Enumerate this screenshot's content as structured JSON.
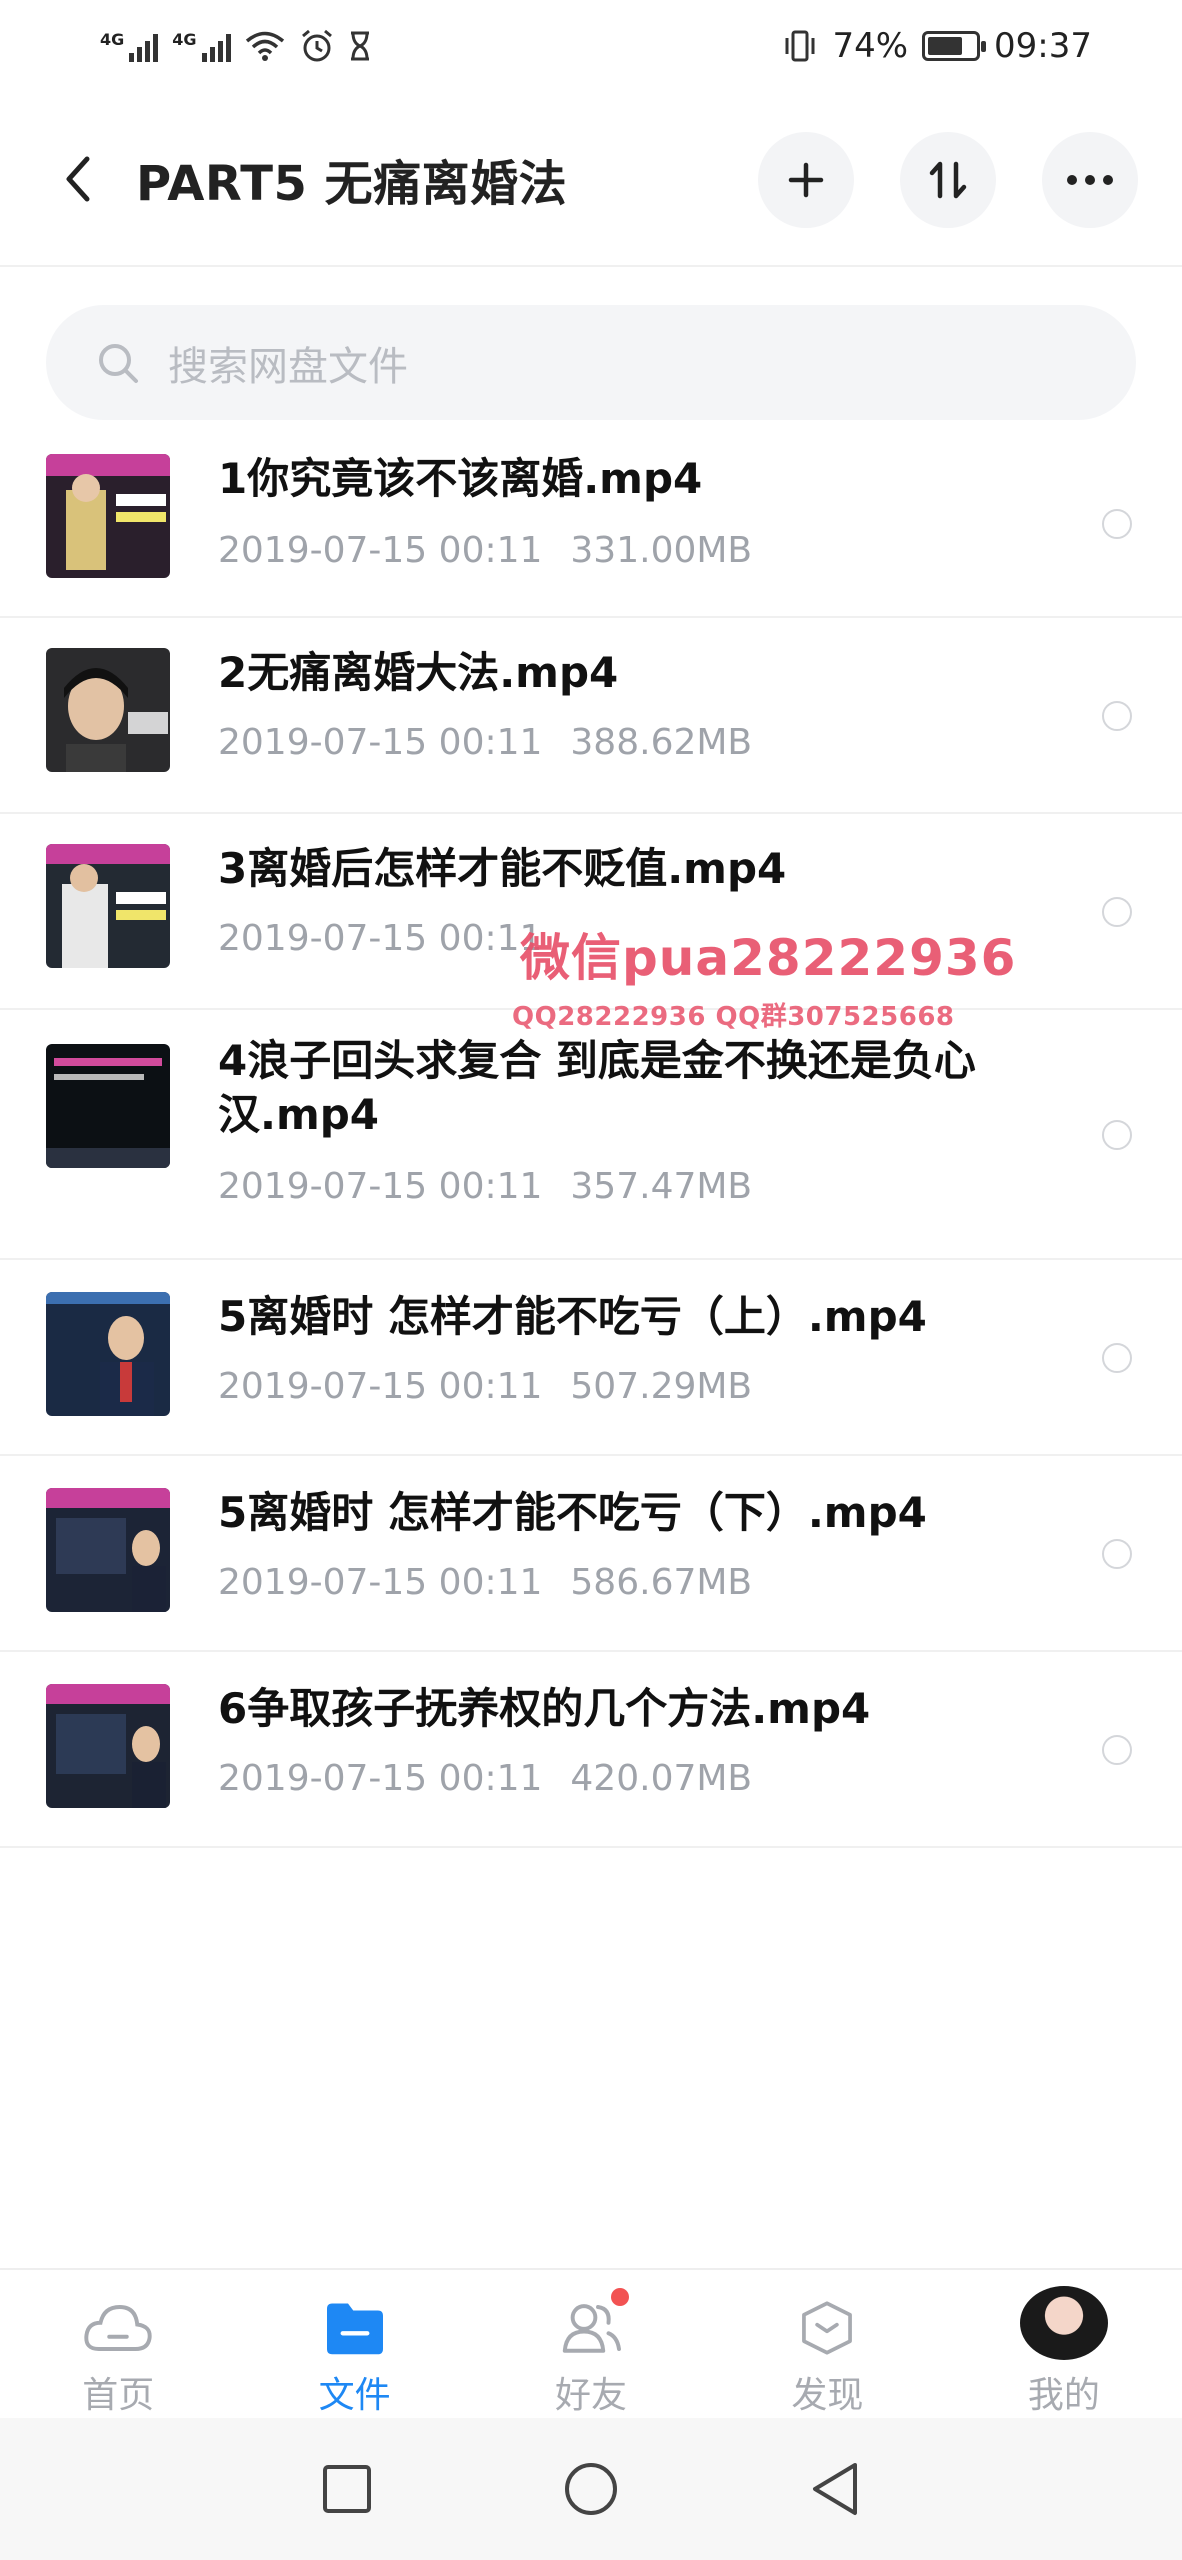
{
  "status_bar": {
    "net_1": "4G",
    "net_2": "4G",
    "battery": "74%",
    "battery_level": 0.74,
    "time": "09:37"
  },
  "header": {
    "title": "PART5 无痛离婚法"
  },
  "search": {
    "placeholder": "搜索网盘文件"
  },
  "files": [
    {
      "name": "1你究竟该不该离婚.mp4",
      "date": "2019-07-15  00:11",
      "size": "331.00MB",
      "thumb_color": "#2a1f2c"
    },
    {
      "name": "2无痛离婚大法.mp4",
      "date": "2019-07-15  00:11",
      "size": "388.62MB",
      "thumb_color": "#2b2b2d"
    },
    {
      "name": "3离婚后怎样才能不贬值.mp4",
      "date": "2019-07-15  00:11",
      "size": "",
      "thumb_color": "#232a33"
    },
    {
      "name": "4浪子回头求复合 到底是金不换还是负心汉.mp4",
      "date": "2019-07-15  00:11",
      "size": "357.47MB",
      "thumb_color": "#0c1014"
    },
    {
      "name": "5离婚时 怎样才能不吃亏（上）.mp4",
      "date": "2019-07-15  00:11",
      "size": "507.29MB",
      "thumb_color": "#1a2a44"
    },
    {
      "name": "5离婚时 怎样才能不吃亏（下）.mp4",
      "date": "2019-07-15  00:11",
      "size": "586.67MB",
      "thumb_color": "#1c2436"
    },
    {
      "name": "6争取孩子抚养权的几个方法.mp4",
      "date": "2019-07-15  00:11",
      "size": "420.07MB",
      "thumb_color": "#1d2433"
    }
  ],
  "watermark": {
    "line1": "微信pua28222936",
    "line2": "QQ28222936 QQ群307525668"
  },
  "tabs": [
    {
      "label": "首页",
      "icon": "cloud-icon"
    },
    {
      "label": "文件",
      "icon": "folder-icon"
    },
    {
      "label": "好友",
      "icon": "friends-icon"
    },
    {
      "label": "发现",
      "icon": "discover-icon"
    },
    {
      "label": "我的",
      "icon": "avatar"
    }
  ],
  "colors": {
    "accent": "#1e88f4",
    "badge": "#f25252",
    "watermark": "#e8526b"
  }
}
